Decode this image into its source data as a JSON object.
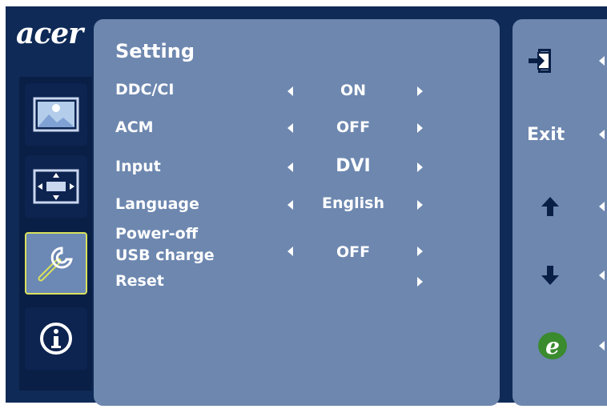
{
  "brand": {
    "logo_text": "acer"
  },
  "sidebar": {
    "items": [
      {
        "name": "picture",
        "icon": "picture-icon",
        "active": false
      },
      {
        "name": "position",
        "icon": "position-icon",
        "active": false
      },
      {
        "name": "setting",
        "icon": "wrench-icon",
        "active": true
      },
      {
        "name": "information",
        "icon": "info-icon",
        "active": false
      }
    ]
  },
  "main": {
    "title": "Setting",
    "rows": [
      {
        "label": "DDC/CI",
        "value": "ON",
        "has_left": true,
        "has_right": true
      },
      {
        "label": "ACM",
        "value": "OFF",
        "has_left": true,
        "has_right": true
      },
      {
        "label": "Input",
        "value": "DVI",
        "has_left": true,
        "has_right": true
      },
      {
        "label": "Language",
        "value": "English",
        "has_left": true,
        "has_right": true
      },
      {
        "label_line1": "Power-off",
        "label_line2": "USB charge",
        "value": "OFF",
        "has_left": true,
        "has_right": true
      },
      {
        "label": "Reset",
        "value": "",
        "has_left": false,
        "has_right": true
      }
    ]
  },
  "right_panel": {
    "items": [
      {
        "name": "menu-exit",
        "icon": "exit-door-icon"
      },
      {
        "name": "exit",
        "label": "Exit"
      },
      {
        "name": "up",
        "icon": "arrow-up-icon"
      },
      {
        "name": "down",
        "icon": "arrow-down-icon"
      },
      {
        "name": "empowering",
        "icon": "e-key-icon"
      }
    ]
  },
  "colors": {
    "frame": "#0f2a56",
    "panel": "#6d87af",
    "active_border": "#d8e25c",
    "e_key": "#3a8a2e"
  }
}
